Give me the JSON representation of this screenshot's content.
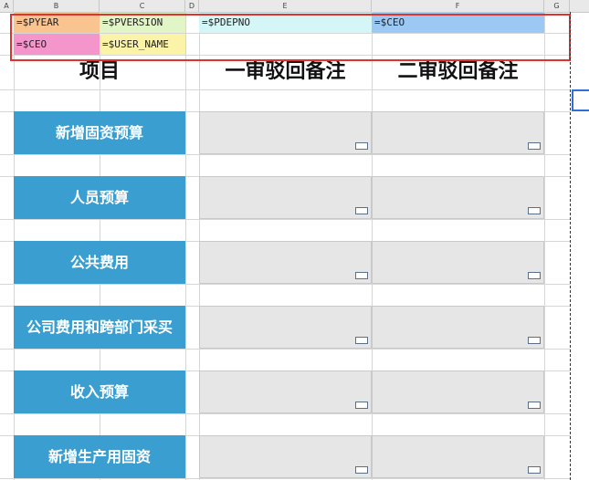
{
  "columns": [
    "A",
    "B",
    "C",
    "D",
    "E",
    "F",
    "G"
  ],
  "formulas": {
    "b1": "=$PYEAR",
    "c1": "=$PVERSION",
    "e1": "=$PDEPNO",
    "f1": "=$CEO",
    "b2": "=$CEO",
    "c2": "=$USER_NAME"
  },
  "headers": {
    "item": "项目",
    "first_review": "一审驳回备注",
    "second_review": "二审驳回备注"
  },
  "rows": [
    "新增固资预算",
    "人员预算",
    "公共费用",
    "公司费用和跨部门采买",
    "收入预算",
    "新增生产用固资"
  ],
  "colors": {
    "pyear": "#f9c490",
    "pversion": "#e2f5c6",
    "pdepno": "#d4f6f6",
    "ceo_f": "#9cc8f4",
    "ceo_b": "#f496cc",
    "user_name": "#fbf3a8",
    "label_bg": "#3a9fd0",
    "highlight": "#e0332d"
  }
}
